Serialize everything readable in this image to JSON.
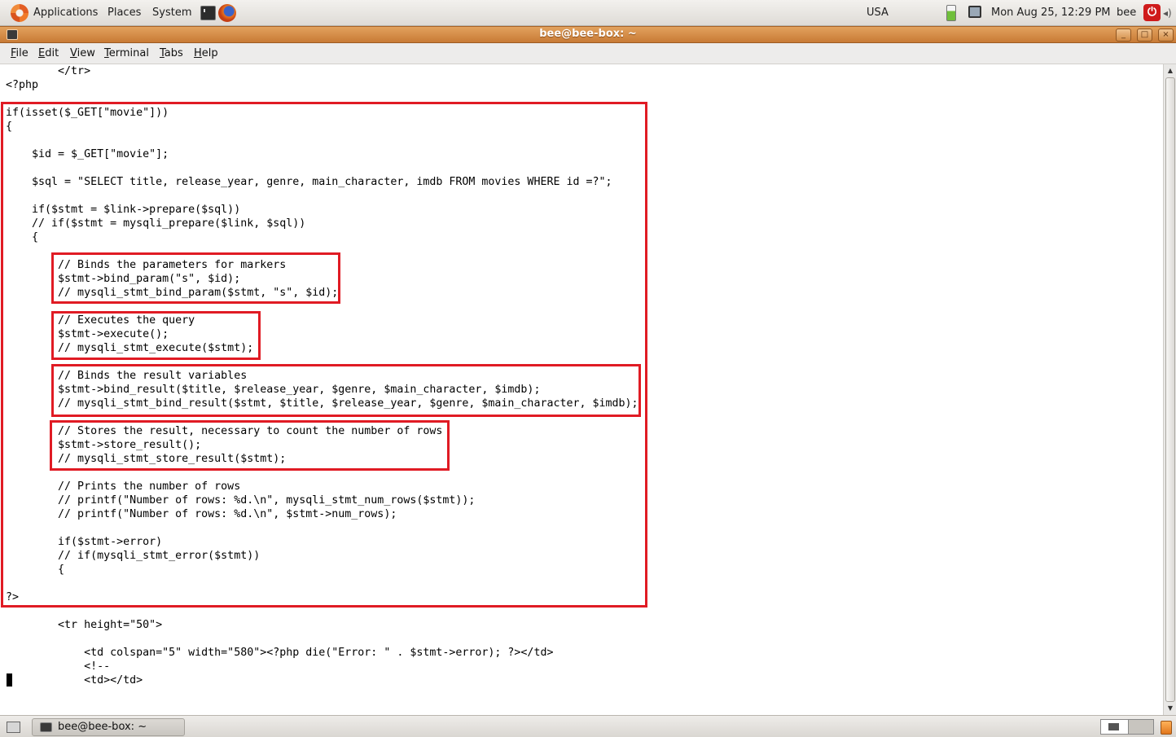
{
  "top_panel": {
    "menus": [
      "Applications",
      "Places",
      "System"
    ],
    "keyboard_layout": "USA",
    "datetime": "Mon Aug 25, 12:29 PM",
    "user": "bee"
  },
  "window": {
    "title": "bee@bee-box: ~",
    "minimize_label": "_",
    "maximize_label": "□",
    "close_label": "×"
  },
  "menubar": {
    "items": [
      "File",
      "Edit",
      "View",
      "Terminal",
      "Tabs",
      "Help"
    ]
  },
  "terminal": {
    "lines": [
      "        </tr>",
      "<?php",
      "",
      "if(isset($_GET[\"movie\"]))",
      "{",
      "",
      "    $id = $_GET[\"movie\"];",
      "",
      "    $sql = \"SELECT title, release_year, genre, main_character, imdb FROM movies WHERE id =?\";",
      "",
      "    if($stmt = $link->prepare($sql))",
      "    // if($stmt = mysqli_prepare($link, $sql))",
      "    {",
      "",
      "        // Binds the parameters for markers",
      "        $stmt->bind_param(\"s\", $id);",
      "        // mysqli_stmt_bind_param($stmt, \"s\", $id);",
      "",
      "        // Executes the query",
      "        $stmt->execute();",
      "        // mysqli_stmt_execute($stmt);",
      "",
      "        // Binds the result variables",
      "        $stmt->bind_result($title, $release_year, $genre, $main_character, $imdb);",
      "        // mysqli_stmt_bind_result($stmt, $title, $release_year, $genre, $main_character, $imdb);",
      "",
      "        // Stores the result, necessary to count the number of rows",
      "        $stmt->store_result();",
      "        // mysqli_stmt_store_result($stmt);",
      "",
      "        // Prints the number of rows",
      "        // printf(\"Number of rows: %d.\\n\", mysqli_stmt_num_rows($stmt));",
      "        // printf(\"Number of rows: %d.\\n\", $stmt->num_rows);",
      "",
      "        if($stmt->error)",
      "        // if(mysqli_stmt_error($stmt))",
      "        {",
      "",
      "?>",
      "",
      "        <tr height=\"50\">",
      "",
      "            <td colspan=\"5\" width=\"580\"><?php die(\"Error: \" . $stmt->error); ?></td>",
      "            <!--",
      "            <td></td>"
    ]
  },
  "bottom_panel": {
    "task_label": "bee@bee-box: ~"
  },
  "colors": {
    "highlight": "#e01b24",
    "titlebar": "#d68a45"
  }
}
